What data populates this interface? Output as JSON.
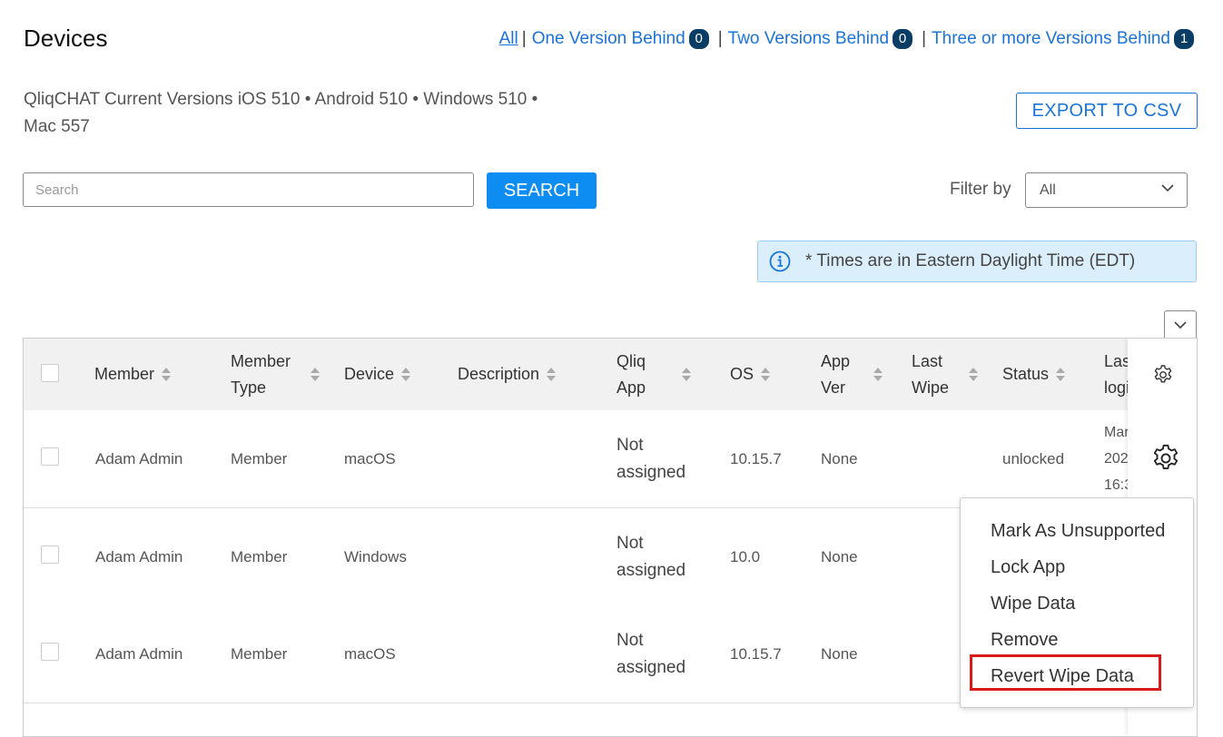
{
  "page_title": "Devices",
  "version_filters": [
    {
      "label": "All"
    },
    {
      "label": "One Version Behind",
      "count": "0"
    },
    {
      "label": "Two Versions Behind",
      "count": "0"
    },
    {
      "label": "Three or more Versions Behind",
      "count": "1"
    }
  ],
  "separator": "|",
  "versions_line1": "QliqCHAT Current Versions iOS 510 • Android 510 • Windows 510 •",
  "versions_line2": "Mac 557",
  "export_label": "EXPORT TO CSV",
  "search": {
    "placeholder": "Search",
    "button": "SEARCH"
  },
  "filter": {
    "label": "Filter by",
    "value": "All"
  },
  "timezone_note": "* Times are in Eastern Daylight Time (EDT)",
  "columns": {
    "member": "Member",
    "member_type_1": "Member",
    "member_type_2": "Type",
    "device": "Device",
    "description": "Description",
    "qliq_app_1": "Qliq",
    "qliq_app_2": "App",
    "os": "OS",
    "app_ver_1": "App",
    "app_ver_2": "Ver",
    "last_wipe_1": "Last",
    "last_wipe_2": "Wipe",
    "status": "Status",
    "last_login_1": "Las",
    "last_login_2": "logi"
  },
  "rows": [
    {
      "member": "Adam Admin",
      "type": "Member",
      "device": "macOS",
      "qliq_1": "Not",
      "qliq_2": "assigned",
      "os": "10.15.7",
      "app_ver": "None",
      "status": "unlocked",
      "login_1": "Mar",
      "login_2": "202",
      "login_3": "16:3"
    },
    {
      "member": "Adam Admin",
      "type": "Member",
      "device": "Windows",
      "qliq_1": "Not",
      "qliq_2": "assigned",
      "os": "10.0",
      "app_ver": "None"
    },
    {
      "member": "Adam Admin",
      "type": "Member",
      "device": "macOS",
      "qliq_1": "Not",
      "qliq_2": "assigned",
      "os": "10.15.7",
      "app_ver": "None"
    }
  ],
  "context_menu": [
    "Mark As Unsupported",
    "Lock App",
    "Wipe Data",
    "Remove",
    "Revert Wipe Data"
  ],
  "icons": {
    "info": "info-icon",
    "gear": "gear-icon",
    "chevron": "chevron-down-icon"
  },
  "colors": {
    "link": "#1a73d9",
    "primary_button": "#0d8cf2",
    "badge": "#0a3d66",
    "highlight": "#d91a1a",
    "banner": "#dbeefc"
  }
}
